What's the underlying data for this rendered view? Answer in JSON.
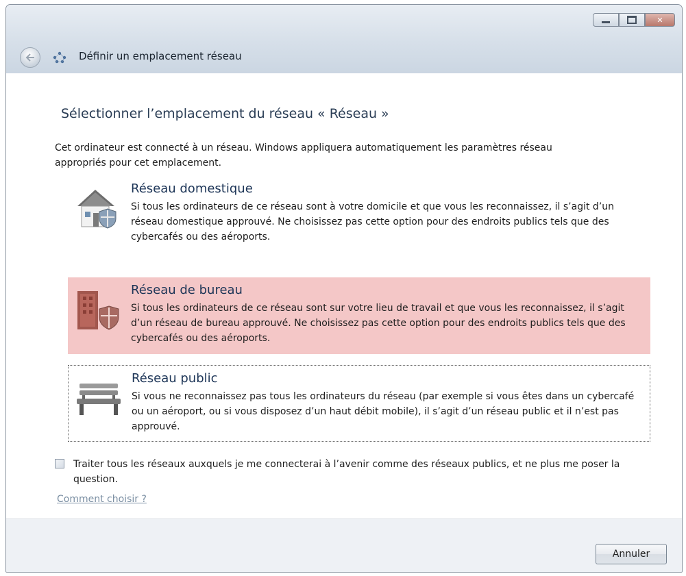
{
  "window": {
    "title": "Définir un emplacement réseau",
    "controls": {
      "minimize_icon": "minimize-icon",
      "maximize_icon": "maximize-icon",
      "close_icon": "close-icon",
      "close_glyph": "✕"
    },
    "back_icon": "back-arrow-icon",
    "title_icon": "network-icon"
  },
  "main": {
    "heading": "Sélectionner l’emplacement du réseau « Réseau »",
    "intro": "Cet ordinateur est connecté à un réseau. Windows appliquera automatiquement les paramètres réseau appropriés pour cet emplacement.",
    "options": [
      {
        "title": "Réseau domestique",
        "description": "Si tous les ordinateurs de ce réseau sont à votre domicile et que vous les reconnaissez, il s’agit d’un réseau domestique approuvé. Ne choisissez pas cette option pour des endroits publics tels que des cybercafés ou des aéroports.",
        "icon": "house-icon",
        "state": "normal"
      },
      {
        "title": "Réseau de bureau",
        "description": "Si tous les ordinateurs de ce réseau sont sur votre lieu de travail et que vous les reconnaissez, il s’agit d’un réseau de bureau approuvé. Ne choisissez pas cette option pour des endroits publics tels que des cybercafés ou des aéroports.",
        "icon": "office-building-icon",
        "state": "selected"
      },
      {
        "title": "Réseau public",
        "description": "Si vous ne reconnaissez pas tous les ordinateurs du réseau (par exemple si vous êtes dans un cybercafé ou un aéroport, ou si vous disposez d’un haut débit mobile), il s’agit d’un réseau public et il n’est pas approuvé.",
        "icon": "park-bench-icon",
        "state": "focused"
      }
    ],
    "checkbox": {
      "label": "Traiter tous les réseaux auxquels je me connecterai à l’avenir comme des réseaux publics, et ne plus me poser la question.",
      "checked": false
    },
    "help_link": "Comment choisir ?"
  },
  "footer": {
    "cancel_label": "Annuler"
  },
  "colors": {
    "selected_bg": "#f4c7c7",
    "heading": "#2a3d55",
    "option_title": "#1d3557",
    "link": "#7b8fa3"
  }
}
